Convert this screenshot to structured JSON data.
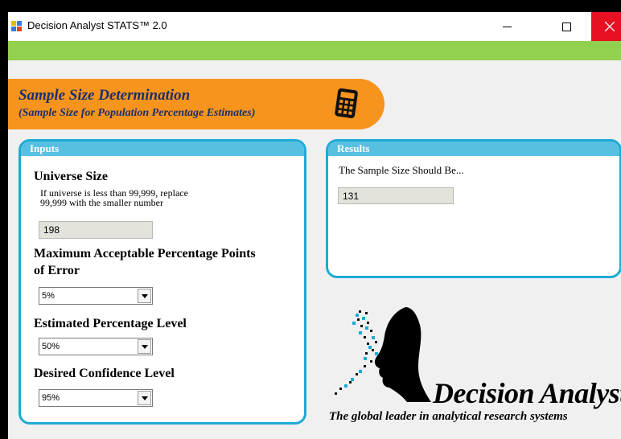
{
  "window": {
    "title": "Decision Analyst STATS™ 2.0",
    "controls": {
      "minimize": "—",
      "close": "✕"
    }
  },
  "banner": {
    "title": "Sample Size Determination",
    "subtitle": "(Sample Size for Population Percentage Estimates)",
    "icon": "calculator-icon"
  },
  "inputs": {
    "header": "Inputs",
    "universe": {
      "label": "Universe Size",
      "help_line1": "If universe is less than 99,999, replace",
      "help_line2": "99,999 with the smaller number",
      "value": "198"
    },
    "error": {
      "label_line1": "Maximum Acceptable Percentage Points",
      "label_line2": "of Error",
      "selected": "5%"
    },
    "estimated": {
      "label": "Estimated Percentage Level",
      "selected": "50%"
    },
    "confidence": {
      "label": "Desired Confidence Level",
      "selected": "95%"
    }
  },
  "results": {
    "header": "Results",
    "label": "The Sample Size Should Be...",
    "value": "131"
  },
  "brand": {
    "name": "Decision Analyst",
    "tagline": "The global leader in analytical research systems"
  },
  "colors": {
    "green_bar": "#92d050",
    "banner": "#f7941d",
    "panel_border": "#1eaad6",
    "panel_header": "#57c0e2",
    "close_button": "#e81123"
  }
}
